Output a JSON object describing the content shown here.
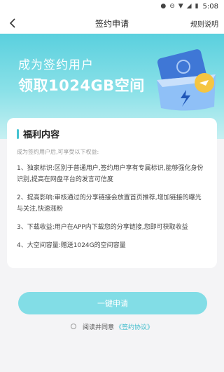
{
  "status_bar": {
    "time": "5:08",
    "icons": [
      "location-icon",
      "dnd-icon",
      "wifi-icon",
      "signal-icon",
      "battery-icon"
    ]
  },
  "nav": {
    "title": "签约申请",
    "rules_label": "规则说明"
  },
  "banner": {
    "subtitle": "成为签约用户",
    "headline": "领取1024GB空间"
  },
  "card": {
    "title": "福利内容",
    "intro": "成为签约用户后,可享受以下权益:",
    "benefits": [
      "1、独家标识:区别于普通用户,签约用户享有专属标识,能够强化身份识别,提高在网盘平台的发言可信度",
      "2、提高影响:审核通过的分享链接会放置首页推荐,增加链接的曝光与关注,快速涨粉",
      "3、下载收益:用户在APP内下载您的分享链接,您即可获取收益",
      "4、大空间容量:赠送1024G的空间容量"
    ]
  },
  "apply_button_label": "一键申请",
  "agreement": {
    "text": "阅读并同意",
    "link": "《签约协议》"
  },
  "colors": {
    "accent": "#45c3d1",
    "button": "#82dde6",
    "banner_top": "#5ad0de"
  }
}
